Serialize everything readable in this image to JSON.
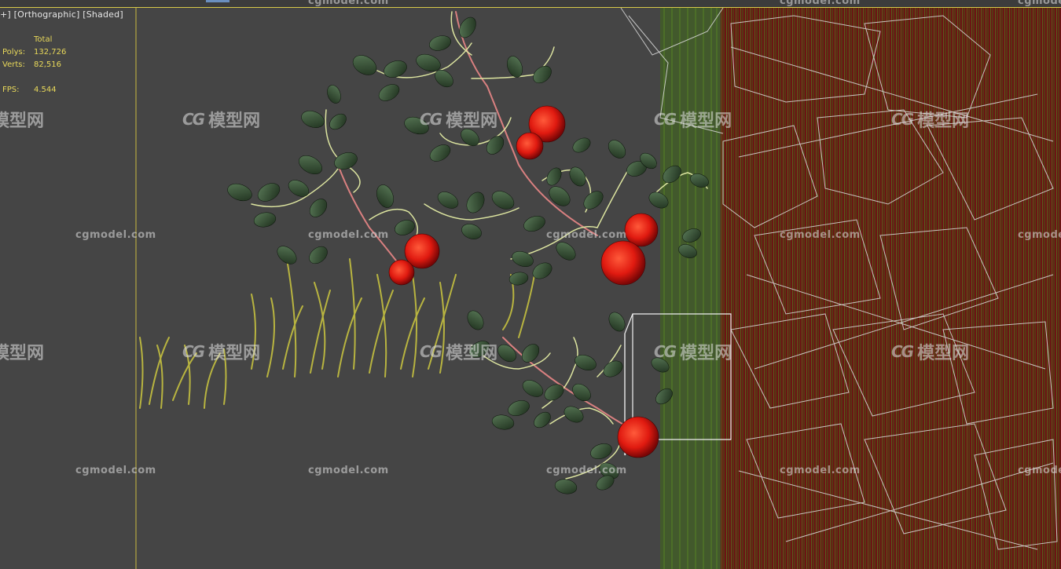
{
  "viewport": {
    "label_parts": [
      "+",
      "Orthographic",
      "Shaded"
    ],
    "background": "#454545",
    "selection_wire_color": "#4a7a1c",
    "panel_color": "#6b1414"
  },
  "stats": {
    "header": "Total",
    "polys_label": "Polys:",
    "polys_value": "132,726",
    "verts_label": "Verts:",
    "verts_value": "82,516",
    "fps_label": "FPS:",
    "fps_value": "4.544",
    "color": "#e8d85a"
  },
  "watermark": {
    "url": "cgmodel.com",
    "logo_mark": "CG",
    "logo_text": "模型网"
  },
  "scene_objects": [
    "rose-vine",
    "rose-flowers",
    "grass-clump",
    "hedge-wireframe",
    "selection-box"
  ]
}
